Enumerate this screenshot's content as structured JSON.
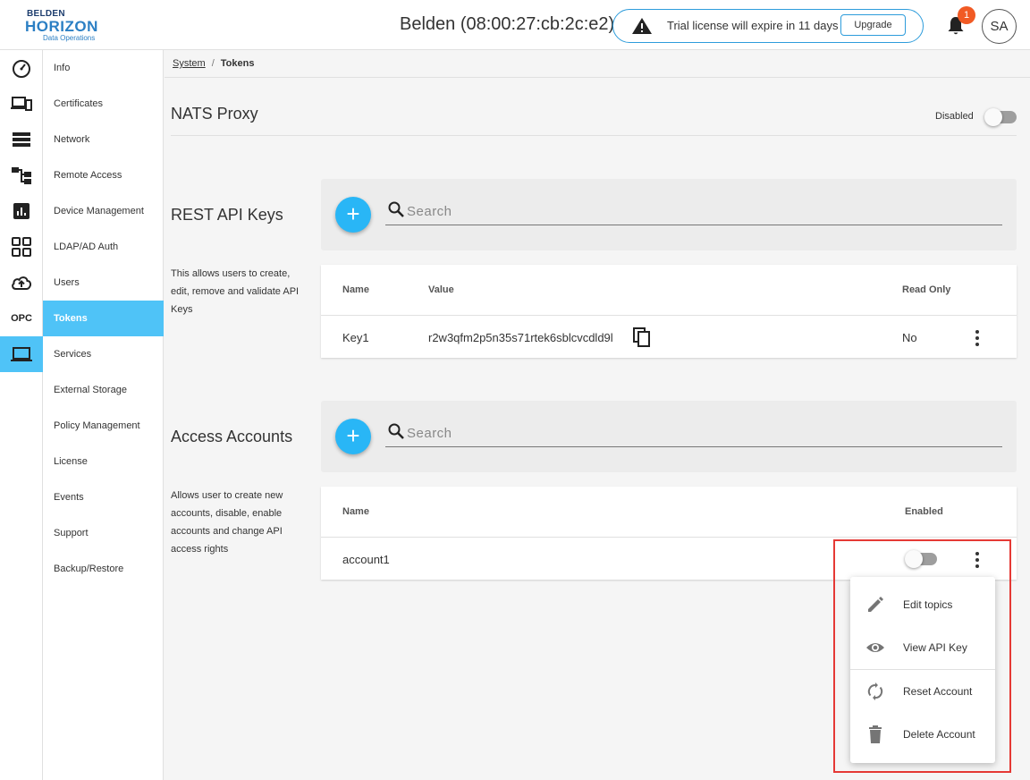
{
  "header": {
    "logo_top": "BELDEN",
    "logo_main": "HORIZON",
    "logo_sub": "Data Operations",
    "device_title": "Belden (08:00:27:cb:2c:e2)",
    "license_text": "Trial license will expire in 11 days",
    "upgrade_label": "Upgrade",
    "notification_count": "1",
    "avatar_initials": "SA"
  },
  "rail": {
    "items": [
      "dashboard-icon",
      "devices-icon",
      "list-icon",
      "hierarchy-icon",
      "analytics-icon",
      "apps-icon",
      "cloud-upload-icon",
      "OPC",
      "laptop-icon"
    ],
    "opc_label": "OPC",
    "active": "laptop-icon"
  },
  "subnav": {
    "items": [
      "Info",
      "Certificates",
      "Network",
      "Remote Access",
      "Device Management",
      "LDAP/AD Auth",
      "Users",
      "Tokens",
      "Services",
      "External Storage",
      "Policy Management",
      "License",
      "Events",
      "Support",
      "Backup/Restore"
    ],
    "active": "Tokens"
  },
  "breadcrumb": {
    "parent": "System",
    "separator": "/",
    "current": "Tokens"
  },
  "nats": {
    "title": "NATS Proxy",
    "status_label": "Disabled",
    "enabled": false
  },
  "rest_api": {
    "title": "REST API Keys",
    "description": "This allows users to create, edit, remove and validate API Keys",
    "add_label": "+",
    "search_placeholder": "Search",
    "columns": [
      "Name",
      "Value",
      "Read Only"
    ],
    "rows": [
      {
        "name": "Key1",
        "value": "r2w3qfm2p5n35s71rtek6sblcvcdld9l",
        "read_only": "No"
      }
    ]
  },
  "access_accounts": {
    "title": "Access Accounts",
    "description": "Allows user to create new accounts, disable, enable accounts and change API access rights",
    "add_label": "+",
    "search_placeholder": "Search",
    "columns": [
      "Name",
      "Enabled"
    ],
    "rows": [
      {
        "name": "account1",
        "enabled": false
      }
    ]
  },
  "context_menu": {
    "items": [
      {
        "label": "Edit topics",
        "icon": "pencil-icon"
      },
      {
        "label": "View API Key",
        "icon": "eye-icon"
      },
      {
        "label": "Reset Account",
        "icon": "sync-icon"
      },
      {
        "label": "Delete Account",
        "icon": "trash-icon"
      }
    ]
  },
  "colors": {
    "accent": "#29b6f6",
    "active_nav": "#4fc3f7",
    "badge": "#f15a24",
    "highlight": "#e53935"
  }
}
